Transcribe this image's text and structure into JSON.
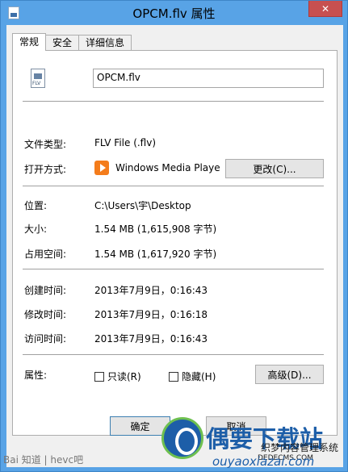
{
  "window": {
    "title": "OPCM.flv 属性",
    "close_label": "✕"
  },
  "tabs": [
    {
      "label": "常规"
    },
    {
      "label": "安全"
    },
    {
      "label": "详细信息"
    }
  ],
  "file": {
    "icon_label": "FLV",
    "name": "OPCM.flv"
  },
  "info": {
    "type_label": "文件类型:",
    "type_value": "FLV File (.flv)",
    "open_label": "打开方式:",
    "open_app": "Windows Media Playe",
    "change_button": "更改(C)...",
    "location_label": "位置:",
    "location_value": "C:\\Users\\宇\\Desktop",
    "size_label": "大小:",
    "size_value": "1.54 MB (1,615,908 字节)",
    "disk_label": "占用空间:",
    "disk_value": "1.54 MB (1,617,920 字节)",
    "created_label": "创建时间:",
    "created_value": "2013年7月9日，0:16:43",
    "modified_label": "修改时间:",
    "modified_value": "2013年7月9日，0:16:18",
    "accessed_label": "访问时间:",
    "accessed_value": "2013年7月9日，0:16:43",
    "attributes_label": "属性:",
    "readonly_label": "只读(R)",
    "hidden_label": "隐藏(H)",
    "advanced_button": "高级(D)..."
  },
  "footer": {
    "ok_label": "确定",
    "cancel_label": "取消"
  },
  "watermark": {
    "left_text": "Bai 知道 | hevc吧",
    "brand": "偶要下载站",
    "site_cn": "织梦内容管理系统",
    "site_en": "DEDECMS.COM",
    "url": "ouyaoxiazai.com"
  }
}
